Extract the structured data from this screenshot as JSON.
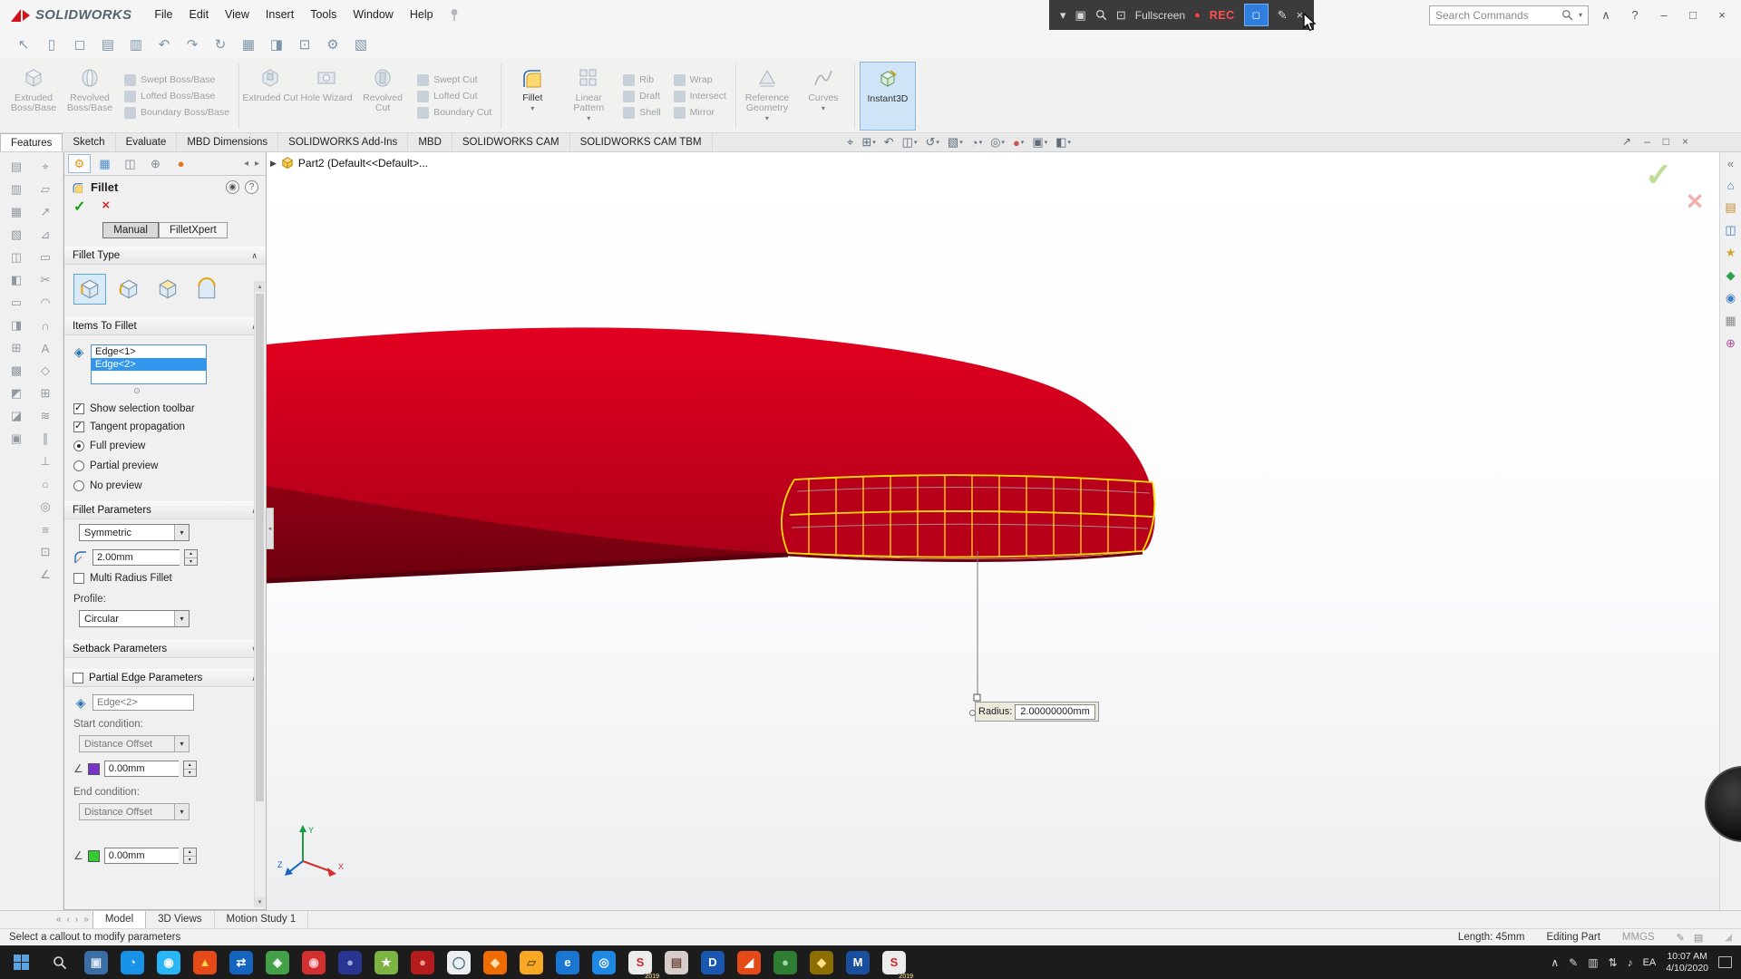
{
  "colors": {
    "model_red": "#c3001c",
    "preview_yellow": "#ffdf00",
    "selection_blue": "#3197ee",
    "accent_red": "#d1121b"
  },
  "app": {
    "logo_text": "SOLIDWORKS",
    "menus": [
      "File",
      "Edit",
      "View",
      "Insert",
      "Tools",
      "Window",
      "Help"
    ]
  },
  "recorder": {
    "fullscreen_label": "Fullscreen",
    "rec_label": "REC",
    "icons": {
      "menu": "▾",
      "window": "▣",
      "fullscreen_icon": "⊡",
      "dot": "●",
      "camera": "◻",
      "pencil": "✎",
      "close": "×"
    }
  },
  "search": {
    "placeholder": "Search Commands"
  },
  "window_controls": {
    "collapse": "∧",
    "help": "?",
    "minimize": "–",
    "maximize": "□",
    "close": "×"
  },
  "quick_toolbar": {
    "icons": [
      "↖",
      "▯",
      "◻",
      "▤",
      "▥",
      "↶",
      "↷",
      "↻",
      "▦",
      "◨",
      "⊡",
      "⚙",
      "▧"
    ]
  },
  "ribbon": {
    "tabs": [
      {
        "label": "Features",
        "cls": "active"
      },
      {
        "label": "Sketch"
      },
      {
        "label": "Evaluate"
      },
      {
        "label": "MBD Dimensions"
      },
      {
        "label": "SOLIDWORKS Add-Ins"
      },
      {
        "label": "MBD"
      },
      {
        "label": "SOLIDWORKS CAM"
      },
      {
        "label": "SOLIDWORKS CAM TBM"
      }
    ],
    "buttons": {
      "extruded_boss": "Extruded Boss/Base",
      "revolved_boss": "Revolved Boss/Base",
      "extruded_cut": "Extruded Cut",
      "hole_wizard": "Hole Wizard",
      "revolved_cut": "Revolved Cut",
      "fillet": "Fillet",
      "linear_pattern": "Linear Pattern",
      "reference_geometry": "Reference Geometry",
      "curves": "Curves",
      "instant3d": "Instant3D"
    },
    "stacks": {
      "boss": [
        "Swept Boss/Base",
        "Lofted Boss/Base",
        "Boundary Boss/Base"
      ],
      "cut": [
        "Swept Cut",
        "Lofted Cut",
        "Boundary Cut"
      ],
      "thin": [
        "Rib",
        "Draft",
        "Shell"
      ],
      "pattern": [
        "Wrap",
        "Intersect",
        "Mirror"
      ]
    }
  },
  "view_toolbar": {
    "icons": [
      {
        "g": "⌖",
        "caret": ""
      },
      {
        "g": "⊞",
        "caret": "▾"
      },
      {
        "g": "↶",
        "caret": ""
      },
      {
        "g": "◫",
        "caret": "▾"
      },
      {
        "g": "↺",
        "caret": "▾"
      },
      {
        "g": "▧",
        "caret": "▾"
      },
      {
        "g": "◔",
        "caret": "▾"
      },
      {
        "g": "◎",
        "caret": "▾"
      },
      {
        "g": "●",
        "caret": "▾",
        "col": "#cc5555"
      },
      {
        "g": "▣",
        "caret": "▾"
      },
      {
        "g": "◧",
        "caret": "▾"
      }
    ]
  },
  "doc_controls": {
    "icons": [
      "↗",
      "–",
      "□",
      "×"
    ]
  },
  "left_toolbar": {
    "col1": [
      "▤",
      "▥",
      "▦",
      "▧",
      "◫",
      "◧",
      "▭",
      "◨",
      "⊞",
      "▩",
      "◩",
      "◪",
      "▣"
    ],
    "col2": [
      "⌖",
      "▱",
      "↗",
      "⊿",
      "▭",
      "✂",
      "◠",
      "∩",
      "A",
      "◇",
      "⊞",
      "≋",
      "∥",
      "⊥",
      "○",
      "◎",
      "≡",
      "⊡",
      "∠"
    ]
  },
  "task_pane": {
    "icons": [
      {
        "g": "«",
        "col": "#777777"
      },
      {
        "g": "⌂",
        "col": "#3b7fc4"
      },
      {
        "g": "▤",
        "col": "#c78b2e"
      },
      {
        "g": "◫",
        "col": "#3b7fc4"
      },
      {
        "g": "★",
        "col": "#d0a72e"
      },
      {
        "g": "◆",
        "col": "#2e9e4f"
      },
      {
        "g": "◉",
        "col": "#3b7fc4"
      },
      {
        "g": "▦",
        "col": "#8a8a8a"
      },
      {
        "g": "⊕",
        "col": "#b04a9e"
      }
    ]
  },
  "property_manager": {
    "title": "Fillet",
    "pm_tabs": [
      {
        "g": "⚙",
        "col": "#e09a10",
        "cls": "active"
      },
      {
        "g": "▦",
        "col": "#4a90d2",
        "cls": ""
      },
      {
        "g": "◫",
        "col": "#7a8794",
        "cls": ""
      },
      {
        "g": "⊕",
        "col": "#7a8794",
        "cls": ""
      },
      {
        "g": "●",
        "col": "#e07820",
        "cls": ""
      }
    ],
    "modes": [
      {
        "label": "Manual",
        "cls": "active"
      },
      {
        "label": "FilletXpert",
        "cls": ""
      }
    ],
    "sections": {
      "fillet_type": "Fillet Type",
      "items_to_fillet": "Items To Fillet",
      "fillet_parameters": "Fillet Parameters",
      "setback_parameters": "Setback Parameters",
      "partial_edge_parameters": "Partial Edge Parameters"
    },
    "edges": [
      {
        "label": "Edge<1>",
        "cls": ""
      },
      {
        "label": "Edge<2>",
        "cls": "sel"
      }
    ],
    "show_selection_toolbar": "Show selection toolbar",
    "tangent_propagation": "Tangent propagation",
    "previews": [
      {
        "label": "Full preview",
        "cls": "on"
      },
      {
        "label": "Partial preview",
        "cls": ""
      },
      {
        "label": "No preview",
        "cls": ""
      }
    ],
    "symmetric_value": "Symmetric",
    "radius_value": "2.00mm",
    "multi_radius_label": "Multi Radius Fillet",
    "profile_label": "Profile:",
    "profile_value": "Circular",
    "partial": {
      "edge": "Edge<2>",
      "start_label": "Start condition:",
      "start_value": "Distance Offset",
      "offset_value": "0.00mm",
      "end_label": "End condition:",
      "end_value": "Distance Offset",
      "end_offset": "0.00mm"
    }
  },
  "viewport": {
    "breadcrumb": "Part2  (Default<<Default>...",
    "callout_label": "Radius:",
    "callout_value": "2.00000000mm"
  },
  "doc_tabs": {
    "nav": [
      "«",
      "‹",
      "›",
      "»"
    ],
    "tabs": [
      {
        "label": "Model",
        "cls": "active"
      },
      {
        "label": "3D Views",
        "cls": ""
      },
      {
        "label": "Motion Study 1",
        "cls": ""
      }
    ]
  },
  "status_bar": {
    "message": "Select a callout to modify parameters",
    "length": "Length: 45mm",
    "mode": "Editing Part",
    "units": "MMGS",
    "icons": [
      "✎",
      "▤"
    ]
  },
  "taskbar": {
    "apps": [
      {
        "bg": "#3a6ea5",
        "g": "▣",
        "fg": "#d8e6f2",
        "badge": ""
      },
      {
        "bg": "#1792e8",
        "g": "◔",
        "fg": "#ffffff",
        "badge": ""
      },
      {
        "bg": "#29b6f6",
        "g": "◉",
        "fg": "#ffffff",
        "badge": ""
      },
      {
        "bg": "#e64a19",
        "g": "▲",
        "fg": "#ffd54f",
        "badge": ""
      },
      {
        "bg": "#1565c0",
        "g": "⇄",
        "fg": "#ffffff",
        "badge": ""
      },
      {
        "bg": "#43a047",
        "g": "◈",
        "fg": "#ffffff",
        "badge": ""
      },
      {
        "bg": "#d32f2f",
        "g": "◉",
        "fg": "#ffcdd2",
        "badge": ""
      },
      {
        "bg": "#283593",
        "g": "●",
        "fg": "#9fa8da",
        "badge": ""
      },
      {
        "bg": "#7cb342",
        "g": "★",
        "fg": "#ffffff",
        "badge": ""
      },
      {
        "bg": "#b71c1c",
        "g": "●",
        "fg": "#ef9a9a",
        "badge": ""
      },
      {
        "bg": "#eceff1",
        "g": "◯",
        "fg": "#546e7a",
        "badge": ""
      },
      {
        "bg": "#ef6c00",
        "g": "◆",
        "fg": "#ffe0b2",
        "badge": ""
      },
      {
        "bg": "#f9a825",
        "g": "▱",
        "fg": "#7a5800",
        "badge": ""
      },
      {
        "bg": "#1976d2",
        "g": "e",
        "fg": "#ffffff",
        "badge": ""
      },
      {
        "bg": "#1e88e5",
        "g": "◎",
        "fg": "#ffffff",
        "badge": ""
      },
      {
        "bg": "#ececec",
        "g": "S",
        "fg": "#c62828",
        "badge": "2019"
      },
      {
        "bg": "#d7ccc8",
        "g": "▤",
        "fg": "#6d4c41",
        "badge": ""
      },
      {
        "bg": "#1a57b0",
        "g": "D",
        "fg": "#ffffff",
        "badge": ""
      },
      {
        "bg": "#e64a19",
        "g": "◢",
        "fg": "#ffffff",
        "badge": ""
      },
      {
        "bg": "#2e7d32",
        "g": "●",
        "fg": "#a5d6a7",
        "badge": ""
      },
      {
        "bg": "#8d6e00",
        "g": "◆",
        "fg": "#ffe082",
        "badge": ""
      },
      {
        "bg": "#1a4fa0",
        "g": "M",
        "fg": "#ffffff",
        "badge": ""
      },
      {
        "bg": "#ececec",
        "g": "S",
        "fg": "#c62828",
        "badge": "2019"
      }
    ],
    "tray_icons": [
      "∧",
      "✎",
      "▥",
      "⇅",
      "♪"
    ],
    "lang": "EA",
    "time": "10:07 AM",
    "date": "4/10/2020"
  },
  "glyphs": {
    "caret_down": "▾",
    "chevron_up": "∧",
    "chevron_down": "∨",
    "ok": "✓",
    "cancel": "×",
    "help": "?",
    "pin": "◉",
    "handle": "⊙",
    "spin_up": "▴",
    "spin_down": "▾",
    "nav_left": "◂",
    "nav_right": "▸",
    "breadcrumb_arrow": "▶",
    "edge": "◈",
    "offset_icon": "∠",
    "collapse": "◂",
    "grip": "◢",
    "scroll_up": "▴",
    "scroll_down": "▾"
  }
}
